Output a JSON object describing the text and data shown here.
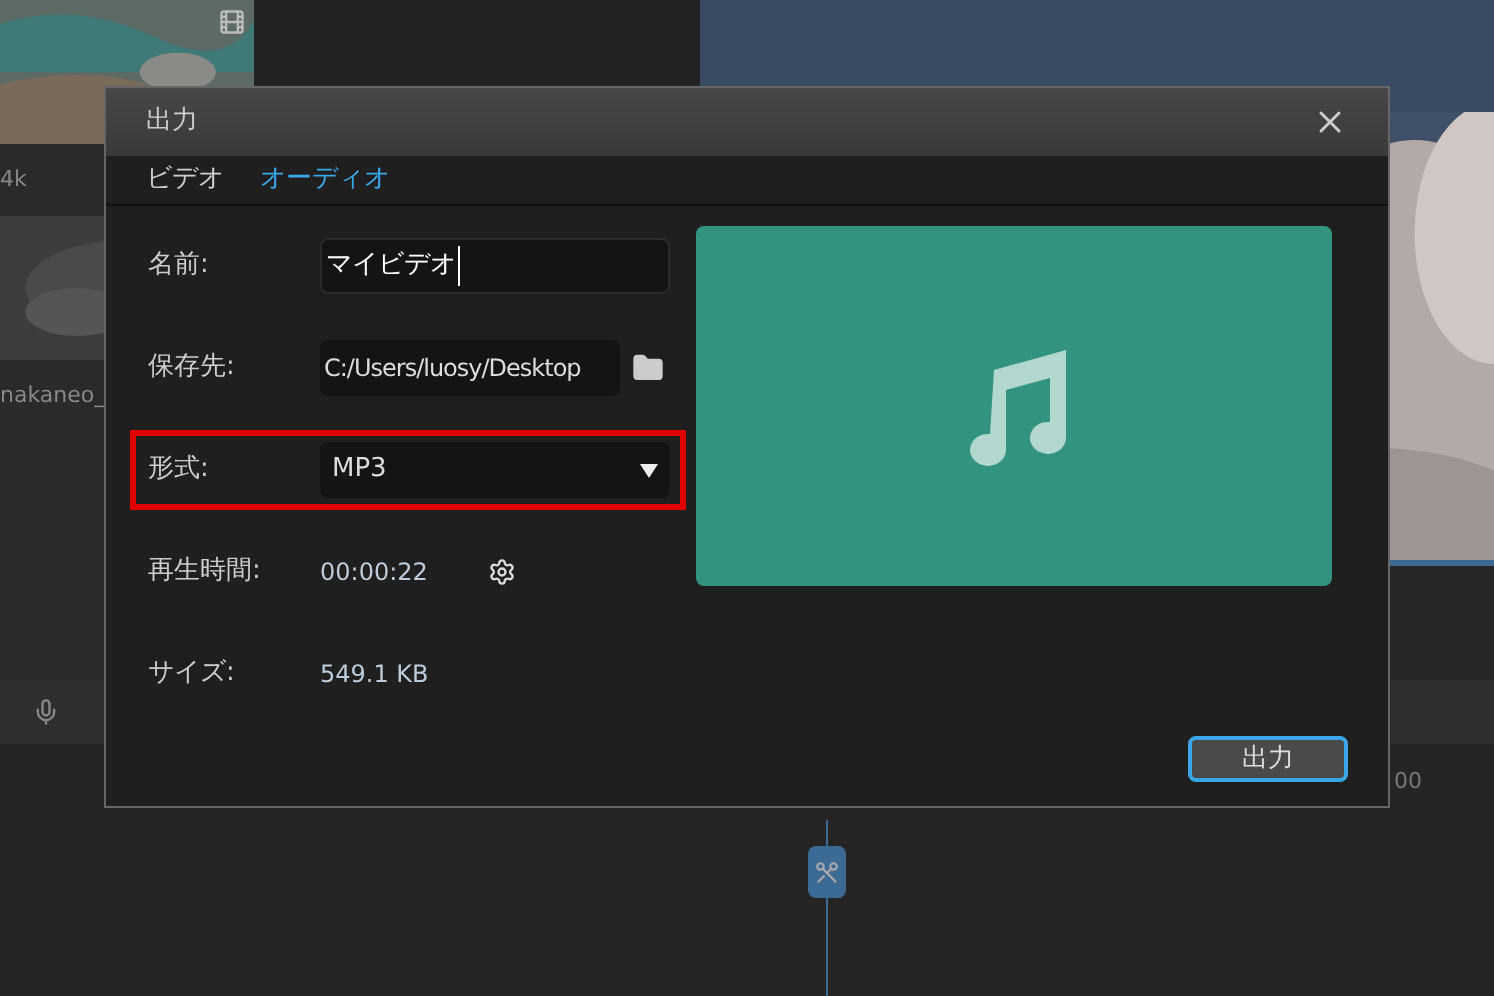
{
  "background": {
    "media": [
      {
        "kind": "picture",
        "label": "4k"
      },
      {
        "kind": "picture",
        "label": "nakaneo_"
      }
    ],
    "ruler_label": "00"
  },
  "dialog": {
    "title": "出力",
    "tabs": [
      {
        "label": "ビデオ",
        "selected": false
      },
      {
        "label": "オーディオ",
        "selected": true
      }
    ],
    "fields": [
      {
        "kind": "input",
        "label": "名前:",
        "value": "マイビデオ",
        "highlighted": false
      },
      {
        "kind": "folder",
        "label": "保存先:",
        "value": "C:/Users/luosy/Desktop",
        "highlighted": false
      },
      {
        "kind": "select",
        "label": "形式:",
        "value": "MP3",
        "highlighted": true
      },
      {
        "kind": "setting",
        "label": "再生時間:",
        "value": "00:00:22",
        "highlighted": false
      },
      {
        "kind": "text",
        "label": "サイズ:",
        "value": "549.1 KB",
        "highlighted": false
      }
    ],
    "button": "出力"
  }
}
